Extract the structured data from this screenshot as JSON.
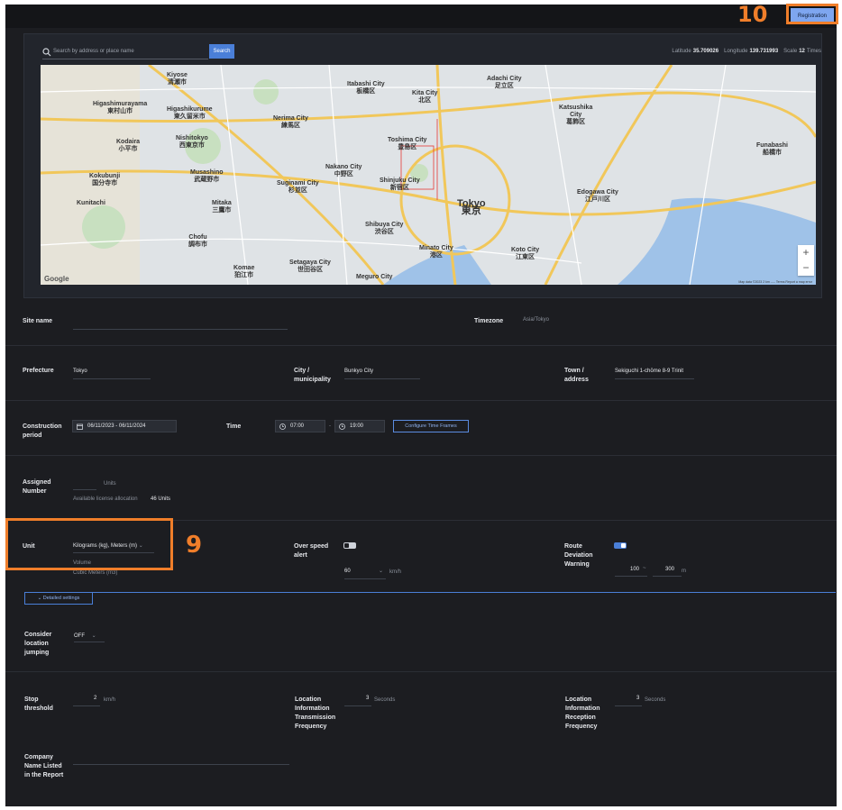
{
  "registration_label": "Registration",
  "callouts": {
    "unit": "9",
    "registration": "10"
  },
  "search": {
    "placeholder": "Search by address or place name",
    "button": "Search"
  },
  "coords": {
    "lat_label": "Latitude",
    "lat": "35.709026",
    "lng_label": "Longitude",
    "lng": "139.731993",
    "scale_label": "Scale",
    "scale": "12",
    "scale_unit": "Times"
  },
  "map": {
    "labels": {
      "itabashi": "Itabashi City\n板橋区",
      "kita": "Kita City\n北区",
      "adachi": "Adachi City\n足立区",
      "katsushika": "Katsushika\nCity\n葛飾区",
      "nerima": "Nerima City\n練馬区",
      "toshima": "Toshima City\n豊島区",
      "nakano": "Nakano City\n中野区",
      "suginami": "Suginami City\n杉並区",
      "shinjuku": "Shinjuku City\n新宿区",
      "tokyo": "Tokyo\n東京",
      "edogawa": "Edogawa City\n江戸川区",
      "shibuya": "Shibuya City\n渋谷区",
      "minato": "Minato City\n港区",
      "koto": "Koto City\n江東区",
      "setagaya": "Setagaya City\n世田谷区",
      "meguro": "Meguro City",
      "funabashi": "Funabashi\n船橋市",
      "kokubunji": "Kokubunji\n国分寺市",
      "mitaka": "Mitaka\n三鷹市",
      "musashino": "Musashino\n武蔵野市",
      "chofu": "Chofu\n調布市",
      "komae": "Komae\n狛江市",
      "kiyose": "Kiyose\n清瀬市",
      "higashikurume": "Higashikurume\n東久留米市",
      "kodaira": "Kodaira\n小平市",
      "nishitokyo": "Nishitokyo\n西東京市",
      "kunitachi": "Kunitachi",
      "higashimurayama": "Higashimurayama\n東村山市"
    },
    "zoom_in": "+",
    "zoom_out": "−",
    "google": "Google",
    "footer": "Map data ©2023   2 km ⎯⎯⎯   Terms   Report a map error"
  },
  "site": {
    "label": "Site name",
    "timezone_label": "Timezone",
    "timezone_value": "Asia/Tokyo"
  },
  "address": {
    "prefecture_label": "Prefecture",
    "prefecture_value": "Tokyo",
    "city_label": "City /\nmunicipality",
    "city_value": "Bunkyo City",
    "town_label": "Town /\naddress",
    "town_value": "Sekiguchi 1-chōme 8-9 Trinit"
  },
  "period": {
    "label": "Construction\nperiod",
    "range": "06/11/2023 - 06/11/2024",
    "time_label": "Time",
    "start": "07:00",
    "sep": "-",
    "end": "19:00",
    "configure": "Configure Time Frames"
  },
  "assigned": {
    "label": "Assigned\nNumber",
    "unit": "Units",
    "allocation_label": "Available license allocation",
    "allocation_value": "46 Units"
  },
  "unit": {
    "label": "Unit",
    "value": "Kilograms (kg), Meters (m)",
    "volume": "Volume",
    "volume_value": "Cubic Meters (m3)"
  },
  "overspeed": {
    "label": "Over speed\nalert",
    "value": "60",
    "unit": "km/h"
  },
  "route": {
    "label": "Route\nDeviation\nWarning",
    "min": "100",
    "sep": "~",
    "max": "300",
    "unit": "m"
  },
  "detail_label": "Detailed settings",
  "jumping": {
    "label": "Consider\nlocation\njumping",
    "value": "OFF"
  },
  "stop": {
    "label": "Stop\nthreshold",
    "value": "2",
    "unit": "km/h"
  },
  "transmission": {
    "label": "Location\nInformation\nTransmission\nFrequency",
    "value": "3",
    "unit": "Seconds"
  },
  "reception": {
    "label": "Location\nInformation\nReception\nFrequency",
    "value": "3",
    "unit": "Seconds"
  },
  "company": {
    "label": "Company\nName Listed\nin the Report"
  },
  "colors": {
    "accent": "#4a7fd8",
    "callout": "#f07e2a",
    "bg": "#1c1d21"
  }
}
